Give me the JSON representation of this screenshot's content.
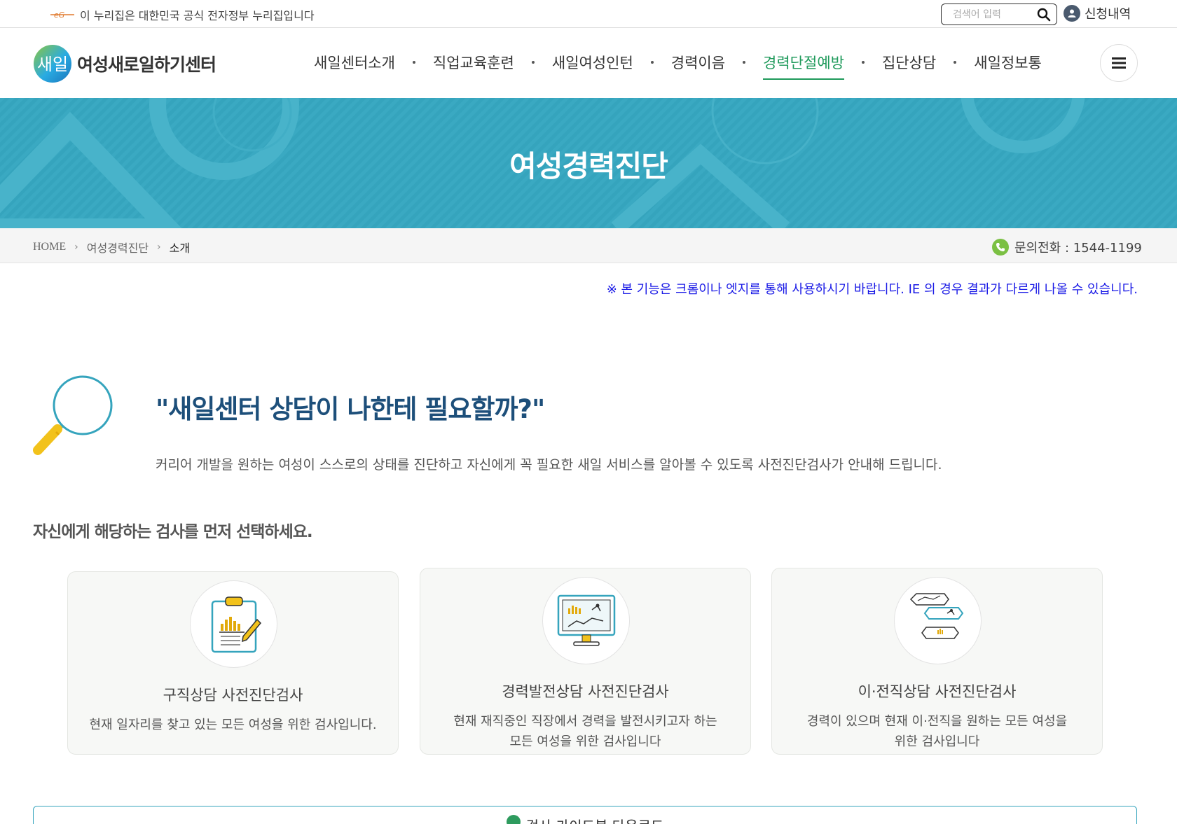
{
  "gov_banner": {
    "text": "이 누리집은 대한민국 공식 전자정부 누리집입니다",
    "search_placeholder": "검색어 입력",
    "apply_label": "신청내역"
  },
  "header": {
    "logo_mark": "새일",
    "logo_text": "여성새로일하기센터",
    "nav": [
      "새일센터소개",
      "직업교육훈련",
      "새일여성인턴",
      "경력이음",
      "경력단절예방",
      "집단상담",
      "새일정보통"
    ],
    "active_nav": "경력단절예방"
  },
  "hero": {
    "title": "여성경력진단"
  },
  "breadcrumb": {
    "home": "HOME",
    "level1": "여성경력진단",
    "current": "소개",
    "phone_label": "문의전화 : 1544-1199"
  },
  "notice": "※ 본 기능은 크롬이나 엣지를 통해 사용하시기 바랍니다. IE 의 경우 결과가 다르게 나올 수 있습니다.",
  "intro": {
    "title": "\"새일센터 상담이 나한테 필요할까?\"",
    "description": "커리어 개발을 원하는 여성이 스스로의 상태를 진단하고 자신에게 꼭 필요한 새일 서비스를 알아볼 수 있도록 사전진단검사가 안내해 드립니다."
  },
  "section_title": "자신에게 해당하는 검사를 먼저 선택하세요.",
  "cards": [
    {
      "title": "구직상담 사전진단검사",
      "desc_line1": "현재 일자리를 찾고 있는 모든 여성을 위한 검사입니다.",
      "desc_line2": ""
    },
    {
      "title": "경력발전상담 사전진단검사",
      "desc_line1": "현재 재직중인 직장에서 경력을 발전시키고자 하는",
      "desc_line2": "모든 여성을 위한 검사입니다"
    },
    {
      "title": "이·전직상담 사전진단검사",
      "desc_line1": "경력이 있으며 현재 이·전직을 원하는 모든 여성을",
      "desc_line2": "위한 검사입니다"
    }
  ],
  "download_label": "검사 가이드북 다운로드",
  "colors": {
    "hero_bg": "#35a4bd",
    "active_nav": "#1f9a5b",
    "notice": "#1a1ae6",
    "intro_title": "#1d4f7a"
  }
}
